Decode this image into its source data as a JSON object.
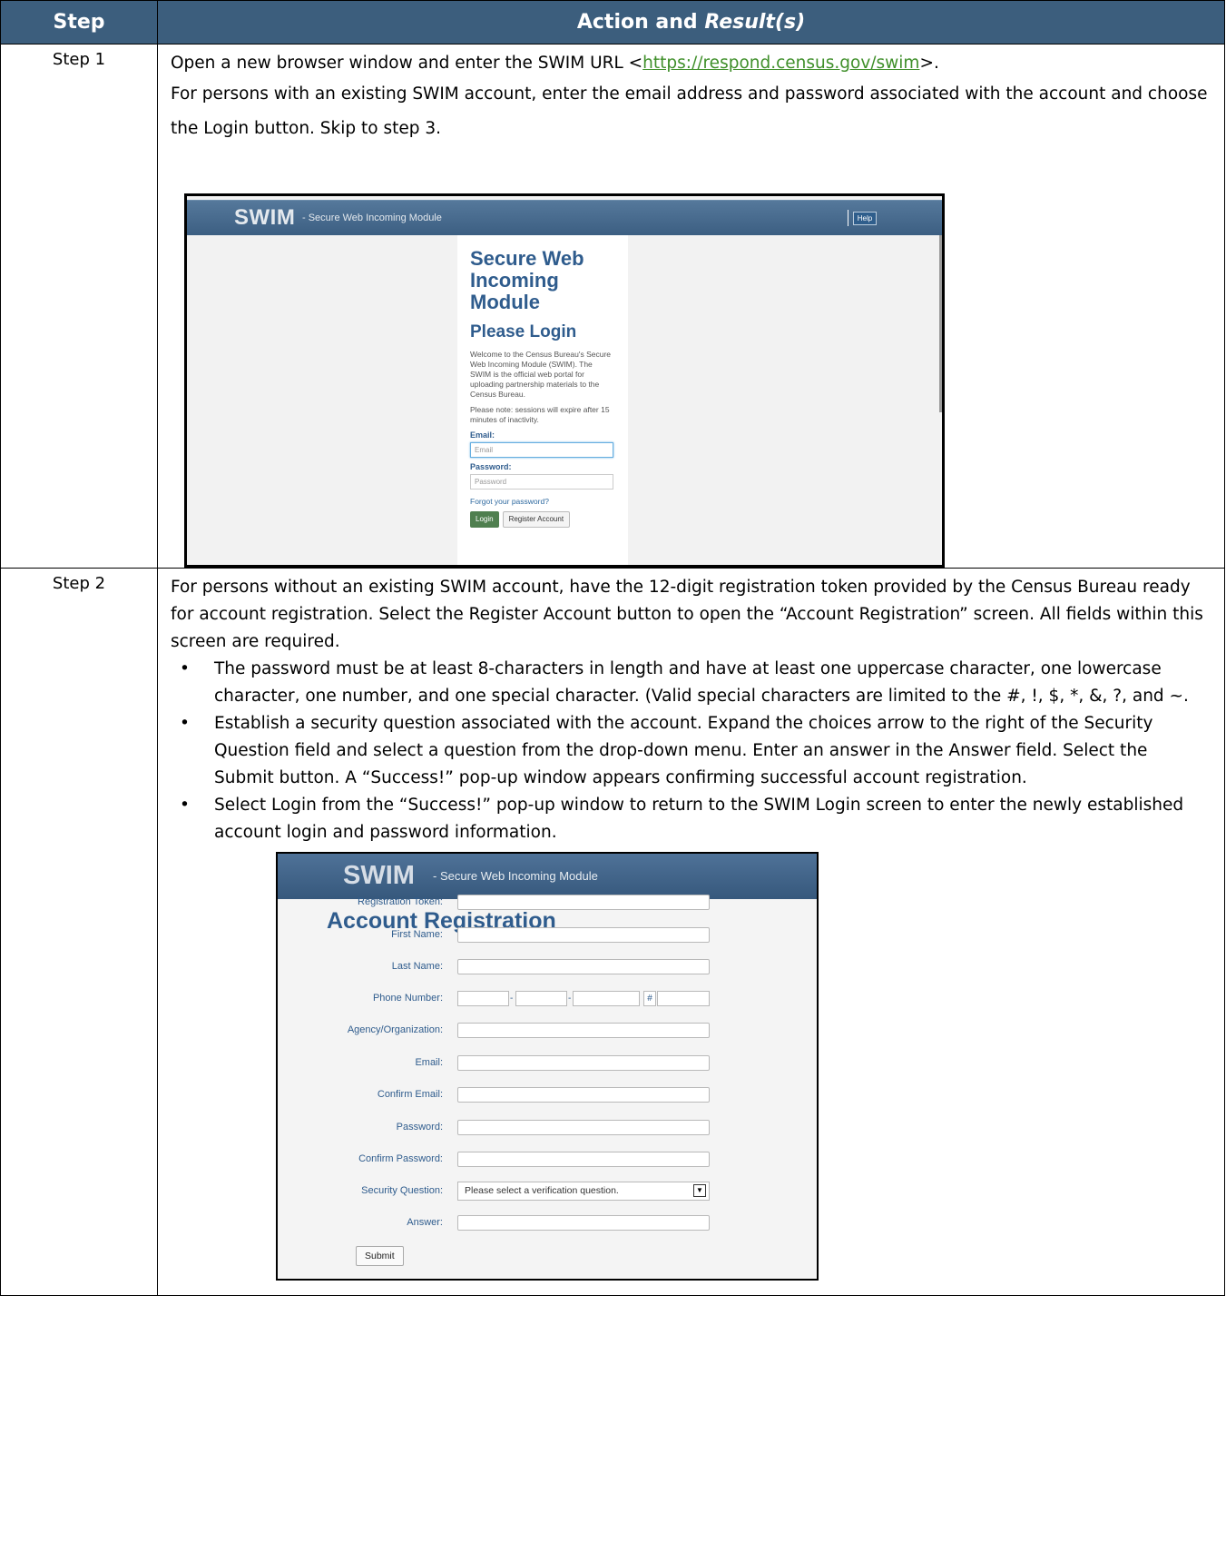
{
  "table": {
    "header_step": "Step",
    "header_action_prefix": "Action and ",
    "header_action_italic": "Result(s)"
  },
  "step1": {
    "label": "Step 1",
    "line1_prefix": "Open a new browser window and enter the SWIM URL <",
    "url": "https://respond.census.gov/swim",
    "line1_suffix": ">.",
    "para2": "For persons with an existing SWIM account, enter the email address and password associated with the account and choose the Login button. Skip to step 3.",
    "screenshot": {
      "logo": "SWIM",
      "tagline": "- Secure Web Incoming Module",
      "help": "Help",
      "title": "Secure Web Incoming Module",
      "subtitle": "Please Login",
      "welcome": "Welcome to the Census Bureau's Secure Web Incoming Module (SWIM). The SWIM is the official web portal for uploading partnership materials to the Census Bureau.",
      "note": "Please note: sessions will expire after 15 minutes of inactivity.",
      "email_label": "Email:",
      "email_placeholder": "Email",
      "password_label": "Password:",
      "password_placeholder": "Password",
      "forgot": "Forgot your password?",
      "login_button": "Login",
      "register_button": "Register Account"
    }
  },
  "step2": {
    "label": "Step 2",
    "intro": "For persons without an existing SWIM account, have the 12-digit registration token provided by the Census Bureau ready for account registration. Select the Register Account button to open the “Account Registration” screen. All fields within this screen are required.",
    "bullets": [
      "The password must be at least 8-characters in length and have at least one uppercase character, one lowercase character, one number, and one special character. (Valid special characters are limited to the #, !, $, *, &, ?, and ~.",
      "Establish a security question associated with the account. Expand the choices arrow to the right of the Security Question field and select a question from the drop-down menu. Enter an answer in the Answer field. Select the Submit button. A “Success!” pop-up window appears confirming successful account registration.",
      "Select Login from the “Success!” pop-up window to return to the SWIM Login screen to enter the newly established account login and password information."
    ],
    "screenshot": {
      "logo": "SWIM",
      "tagline": "- Secure Web Incoming Module",
      "title": "Account Registration",
      "fields": {
        "token": "Registration Token:",
        "first_name": "First Name:",
        "last_name": "Last Name:",
        "phone": "Phone Number:",
        "agency": "Agency/Organization:",
        "email": "Email:",
        "confirm_email": "Confirm Email:",
        "password": "Password:",
        "confirm_password": "Confirm Password:",
        "security_question": "Security Question:",
        "answer": "Answer:"
      },
      "phone_dash": "-",
      "phone_ext": "#",
      "security_selected": "Please select a verification question.",
      "submit": "Submit"
    }
  }
}
